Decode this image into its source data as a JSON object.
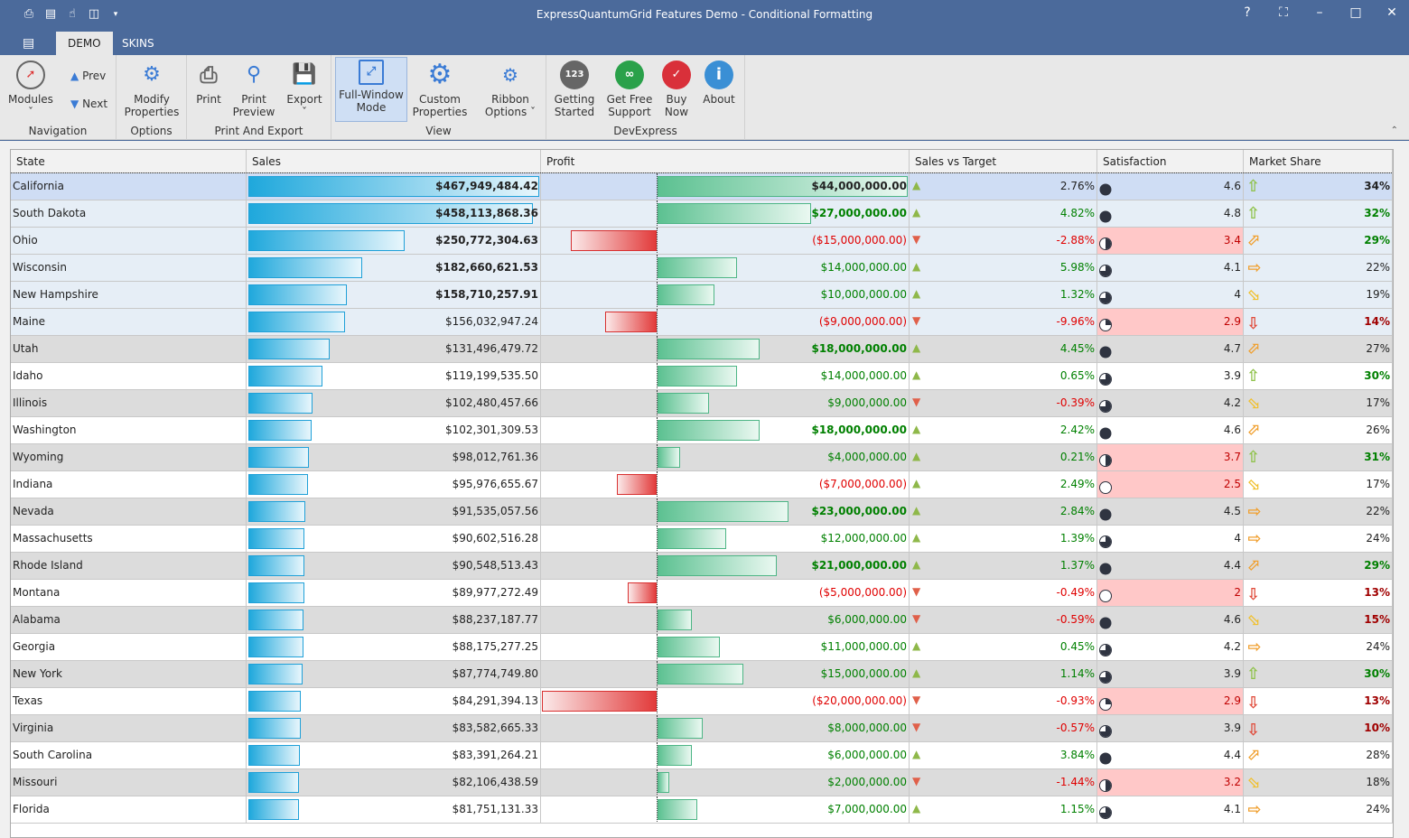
{
  "window": {
    "title": "ExpressQuantumGrid Features Demo -  Conditional Formatting"
  },
  "tabs": [
    "DEMO",
    "SKINS"
  ],
  "ribbon": {
    "navigation": {
      "label": "Navigation",
      "modules": "Modules",
      "prev": "Prev",
      "next": "Next"
    },
    "options": {
      "label": "Options",
      "modify": "Modify Properties"
    },
    "print_export": {
      "label": "Print And Export",
      "print": "Print",
      "preview": "Print Preview",
      "export": "Export"
    },
    "view": {
      "label": "View",
      "fullwindow": "Full-Window Mode",
      "custom": "Custom Properties",
      "ribbon_options": "Ribbon Options"
    },
    "devexpress": {
      "label": "DevExpress",
      "getting_started": "Getting Started",
      "support": "Get Free Support",
      "buy": "Buy Now",
      "about": "About"
    }
  },
  "columns": [
    "State",
    "Sales",
    "Profit",
    "Sales vs Target",
    "Satisfaction",
    "Market Share"
  ],
  "colors": {
    "accent": "#4b6a9b",
    "positive": "#008000",
    "negative": "#e00000",
    "pink": "#ffc8c8",
    "selected": "#cfddf4"
  },
  "rows": [
    [
      "California",
      "$467,949,484.42",
      "$44,000,000.00",
      "2.76%",
      "4.6",
      "34%"
    ],
    [
      "South Dakota",
      "$458,113,868.36",
      "$27,000,000.00",
      "4.82%",
      "4.8",
      "32%"
    ],
    [
      "Ohio",
      "$250,772,304.63",
      "($15,000,000.00)",
      "-2.88%",
      "3.4",
      "29%"
    ],
    [
      "Wisconsin",
      "$182,660,621.53",
      "$14,000,000.00",
      "5.98%",
      "4.1",
      "22%"
    ],
    [
      "New Hampshire",
      "$158,710,257.91",
      "$10,000,000.00",
      "1.32%",
      "4",
      "19%"
    ],
    [
      "Maine",
      "$156,032,947.24",
      "($9,000,000.00)",
      "-9.96%",
      "2.9",
      "14%"
    ],
    [
      "Utah",
      "$131,496,479.72",
      "$18,000,000.00",
      "4.45%",
      "4.7",
      "27%"
    ],
    [
      "Idaho",
      "$119,199,535.50",
      "$14,000,000.00",
      "0.65%",
      "3.9",
      "30%"
    ],
    [
      "Illinois",
      "$102,480,457.66",
      "$9,000,000.00",
      "-0.39%",
      "4.2",
      "17%"
    ],
    [
      "Washington",
      "$102,301,309.53",
      "$18,000,000.00",
      "2.42%",
      "4.6",
      "26%"
    ],
    [
      "Wyoming",
      "$98,012,761.36",
      "$4,000,000.00",
      "0.21%",
      "3.7",
      "31%"
    ],
    [
      "Indiana",
      "$95,976,655.67",
      "($7,000,000.00)",
      "2.49%",
      "2.5",
      "17%"
    ],
    [
      "Nevada",
      "$91,535,057.56",
      "$23,000,000.00",
      "2.84%",
      "4.5",
      "22%"
    ],
    [
      "Massachusetts",
      "$90,602,516.28",
      "$12,000,000.00",
      "1.39%",
      "4",
      "24%"
    ],
    [
      "Rhode Island",
      "$90,548,513.43",
      "$21,000,000.00",
      "1.37%",
      "4.4",
      "29%"
    ],
    [
      "Montana",
      "$89,977,272.49",
      "($5,000,000.00)",
      "-0.49%",
      "2",
      "13%"
    ],
    [
      "Alabama",
      "$88,237,187.77",
      "$6,000,000.00",
      "-0.59%",
      "4.6",
      "15%"
    ],
    [
      "Georgia",
      "$88,175,277.25",
      "$11,000,000.00",
      "0.45%",
      "4.2",
      "24%"
    ],
    [
      "New York",
      "$87,774,749.80",
      "$15,000,000.00",
      "1.14%",
      "3.9",
      "30%"
    ],
    [
      "Texas",
      "$84,291,394.13",
      "($20,000,000.00)",
      "-0.93%",
      "2.9",
      "13%"
    ],
    [
      "Virginia",
      "$83,582,665.33",
      "$8,000,000.00",
      "-0.57%",
      "3.9",
      "10%"
    ],
    [
      "South Carolina",
      "$83,391,264.21",
      "$6,000,000.00",
      "3.84%",
      "4.4",
      "28%"
    ],
    [
      "Missouri",
      "$82,106,438.59",
      "$2,000,000.00",
      "-1.44%",
      "3.2",
      "18%"
    ],
    [
      "Florida",
      "$81,751,131.33",
      "$7,000,000.00",
      "1.15%",
      "4.1",
      "24%"
    ]
  ]
}
